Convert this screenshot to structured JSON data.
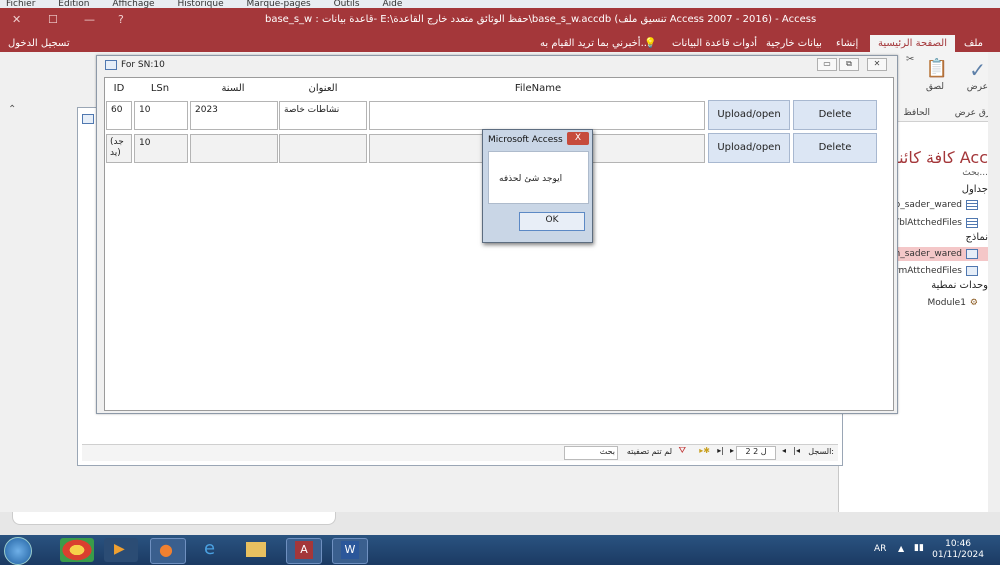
{
  "bg_menu": [
    "Fichier",
    "Edition",
    "Affichage",
    "Historique",
    "Marque-pages",
    "Outils",
    "Aide"
  ],
  "titlebar": {
    "title": "base_s_w : قاعدة بيانات- E:\\حفظ الوثائق متعدد خارج القاعدة\\base_s_w.accdb (تنسيق ملف Access 2007 - 2016) - Access",
    "signin": "تسجيل الدخول"
  },
  "ribbon_tabs": {
    "file": "ملف",
    "home": "الصفحة الرئيسية",
    "create": "إنشاء",
    "external": "بيانات خارجية",
    "dbtools": "أدوات قاعدة البيانات",
    "tell_me": "أخبرني بما تريد القيام به..."
  },
  "ribbon": {
    "view": "عرض",
    "paste": "لصق",
    "views_group": "طرق عرض",
    "clipboard_group": "الحافظ"
  },
  "nav": {
    "title": "كافة كائنات Acc",
    "search": "بحث...",
    "groups": {
      "tables": "جداول",
      "forms": "نماذج",
      "modules": "وحدات نمطية"
    },
    "tables": [
      "tab_sader_wared",
      "TblAttchedFiles"
    ],
    "forms": [
      "frm_sader_wared",
      "FrmAttchedFiles"
    ],
    "modules": [
      "Module1"
    ]
  },
  "front_form": {
    "title": "For SN:10",
    "headers": {
      "id": "ID",
      "lsn": "LSn",
      "year": "السنة",
      "address": "العنوان",
      "filename": "FileName"
    },
    "rows": [
      {
        "id": "60",
        "lsn": "10",
        "year": "2023",
        "address": "نشاطات خاصة",
        "filename": "",
        "upload": "Upload/open",
        "delete": "Delete"
      },
      {
        "id": "(جد يد)",
        "lsn": "10",
        "year": "",
        "address": "",
        "filename": "",
        "upload": "Upload/open",
        "delete": "Delete"
      }
    ]
  },
  "back_form": {
    "record_label": "السجل:",
    "record_value": "2 ل 2",
    "filter": "لم تتم تصفيته",
    "search": "بحث"
  },
  "msgbox": {
    "title": "Microsoft Access",
    "message": "ايوجد شئ لحذفه",
    "ok": "OK",
    "close": "X"
  },
  "taskbar": {
    "lang": "AR",
    "time": "10:46",
    "date": "01/11/2024"
  }
}
